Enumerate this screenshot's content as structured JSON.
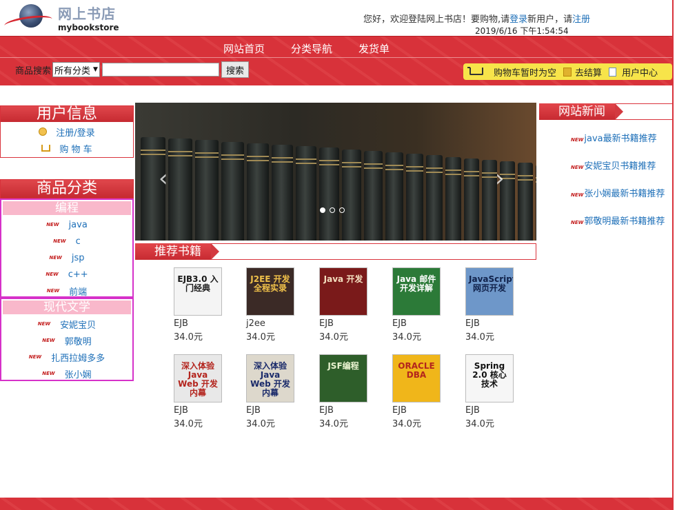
{
  "header": {
    "logo_cn": "网上书店",
    "logo_en": "mybookstore",
    "welcome_prefix": "您好，欢迎登陆网上书店！要购物,请",
    "login_link": "登录",
    "welcome_mid": "新用户，请",
    "register_link": "注册",
    "datetime": "2019/6/16 下午1:54:54"
  },
  "nav": {
    "items": [
      "网站首页",
      "分类导航",
      "发货单"
    ]
  },
  "search": {
    "label": "商品搜索",
    "category_selected": "所有分类",
    "input_value": "",
    "button_label": "搜索"
  },
  "cart": {
    "status": "购物车暂时为空",
    "checkout": "去结算",
    "user_center": "用户中心"
  },
  "user_panel": {
    "title": "用户信息",
    "login_register": "注册/登录",
    "cart_link": "购 物 车"
  },
  "category_panel": {
    "title": "商品分类",
    "new_tag": "NEW",
    "groups": [
      {
        "name": "编程",
        "items": [
          "java",
          "c",
          "jsp",
          "c++",
          "前端"
        ]
      },
      {
        "name": "现代文学",
        "items": [
          "安妮宝贝",
          "郭敬明",
          "扎西拉姆多多",
          "张小娴"
        ]
      }
    ]
  },
  "carousel": {
    "prev": "‹",
    "next": "›",
    "slides": 3,
    "active": 0
  },
  "recommend": {
    "title": "推荐书籍",
    "books": [
      {
        "name": "EJB",
        "price": "34.0元",
        "cover_text": "EJB3.0 入门经典",
        "bg": "#f4f4f4",
        "fg": "#1a1a1a"
      },
      {
        "name": "j2ee",
        "price": "34.0元",
        "cover_text": "J2EE 开发全程实录",
        "bg": "#3b2a26",
        "fg": "#f0c14a"
      },
      {
        "name": "EJB",
        "price": "34.0元",
        "cover_text": "Java 开发",
        "bg": "#7a1a1a",
        "fg": "#f4e0c0"
      },
      {
        "name": "EJB",
        "price": "34.0元",
        "cover_text": "Java 邮件开发详解",
        "bg": "#2c7a38",
        "fg": "#ffffff"
      },
      {
        "name": "EJB",
        "price": "34.0元",
        "cover_text": "JavaScript 网页开发",
        "bg": "#6e97c9",
        "fg": "#10214a"
      },
      {
        "name": "EJB",
        "price": "34.0元",
        "cover_text": "深入体验 Java Web 开发内幕",
        "bg": "#e8e8e8",
        "fg": "#b3241d"
      },
      {
        "name": "EJB",
        "price": "34.0元",
        "cover_text": "深入体验 Java Web 开发内幕",
        "bg": "#ddd8cc",
        "fg": "#1a2a6a"
      },
      {
        "name": "EJB",
        "price": "34.0元",
        "cover_text": "JSF编程",
        "bg": "#2e5e2a",
        "fg": "#e9f3d0"
      },
      {
        "name": "EJB",
        "price": "34.0元",
        "cover_text": "ORACLE DBA",
        "bg": "#f0b61a",
        "fg": "#b3241d"
      },
      {
        "name": "EJB",
        "price": "34.0元",
        "cover_text": "Spring 2.0 核心技术",
        "bg": "#f6f6f6",
        "fg": "#111111"
      }
    ]
  },
  "news": {
    "title": "网站新闻",
    "new_tag": "NEW",
    "items": [
      "java最新书籍推荐",
      "安妮宝贝书籍推荐",
      "张小娴最新书籍推荐",
      "郭敬明最新书籍推荐"
    ]
  },
  "colors": {
    "accent": "#d9323b",
    "link": "#1d6fb8",
    "category_border": "#d631c9",
    "category_head": "#f9b8cb",
    "cartbar": "#f7e44a"
  }
}
